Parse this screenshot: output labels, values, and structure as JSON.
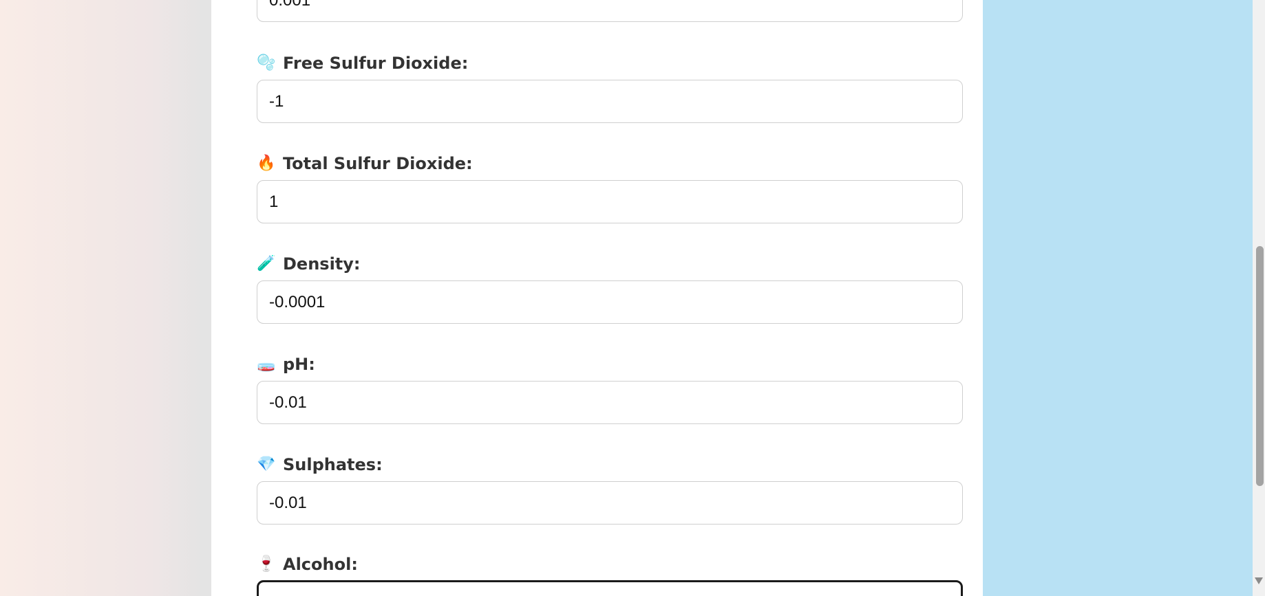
{
  "fields": [
    {
      "icon": "💧",
      "icon_name": "droplet-icon",
      "label": "",
      "value": "0.001"
    },
    {
      "icon": "🫧",
      "icon_name": "bubbles-icon",
      "label": "Free Sulfur Dioxide:",
      "value": "-1"
    },
    {
      "icon": "🔥",
      "icon_name": "fire-icon",
      "label": "Total Sulfur Dioxide:",
      "value": "1"
    },
    {
      "icon": "🧪",
      "icon_name": "test-tube-icon",
      "label": "Density:",
      "value": "-0.0001"
    },
    {
      "icon": "🧫",
      "icon_name": "ph-icon",
      "label": "pH:",
      "value": "-0.01"
    },
    {
      "icon": "💎",
      "icon_name": "gem-icon",
      "label": "Sulphates:",
      "value": "-0.01"
    },
    {
      "icon": "🍷",
      "icon_name": "wine-glass-icon",
      "label": "Alcohol:",
      "value": ""
    }
  ],
  "colors": {
    "panel": "#ffffff",
    "right_background": "#b8e1f4",
    "label_text": "#333333",
    "input_border": "#cfcfcf",
    "focused_border": "#1a1a1a"
  }
}
